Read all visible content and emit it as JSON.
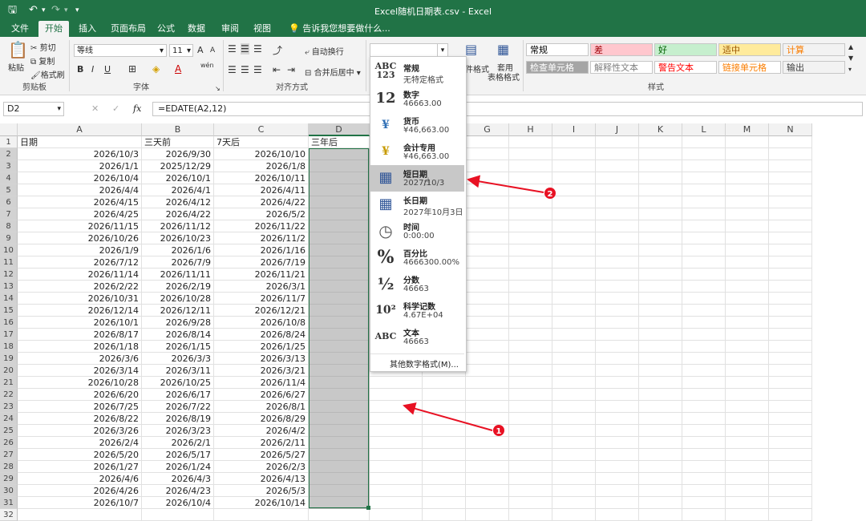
{
  "window": {
    "title": "Excel随机日期表.csv - Excel"
  },
  "tabs": [
    "文件",
    "开始",
    "插入",
    "页面布局",
    "公式",
    "数据",
    "审阅",
    "视图"
  ],
  "tell_me": "告诉我您想要做什么...",
  "clipboard": {
    "paste": "粘贴",
    "cut": "剪切",
    "copy": "复制",
    "format_painter": "格式刷",
    "label": "剪贴板"
  },
  "font": {
    "name": "等线",
    "size": "11",
    "grow": "A",
    "shrink": "A",
    "bold": "B",
    "italic": "I",
    "underline": "U",
    "color_a": "A",
    "wen": "wén",
    "label": "字体"
  },
  "alignment": {
    "wrap": "自动换行",
    "merge": "合并后居中",
    "label": "对齐方式"
  },
  "number": {
    "format_value": ""
  },
  "styles_group": {
    "cond": "件格式",
    "table": "套用",
    "table2": "表格格式",
    "label": "样式"
  },
  "styles": [
    {
      "label": "常规",
      "bg": "#ffffff",
      "fg": "#000000"
    },
    {
      "label": "差",
      "bg": "#ffc7ce",
      "fg": "#9c0006"
    },
    {
      "label": "好",
      "bg": "#c6efce",
      "fg": "#006100"
    },
    {
      "label": "适中",
      "bg": "#ffeb9c",
      "fg": "#9c5700"
    },
    {
      "label": "计算",
      "bg": "#f2f2f2",
      "fg": "#fa7d00"
    },
    {
      "label": "检查单元格",
      "bg": "#a5a5a5",
      "fg": "#ffffff"
    },
    {
      "label": "解释性文本",
      "bg": "#ffffff",
      "fg": "#7f7f7f"
    },
    {
      "label": "警告文本",
      "bg": "#ffffff",
      "fg": "#ff0000"
    },
    {
      "label": "链接单元格",
      "bg": "#ffffff",
      "fg": "#fa7d00"
    },
    {
      "label": "输出",
      "bg": "#f2f2f2",
      "fg": "#3f3f3f"
    }
  ],
  "formula_bar": {
    "cell_ref": "D2",
    "fx": "fx",
    "formula": "=EDATE(A2,12)"
  },
  "columns": [
    "A",
    "B",
    "C",
    "D",
    "E",
    "F",
    "G",
    "H",
    "I",
    "J",
    "K",
    "L",
    "M",
    "N"
  ],
  "headers": [
    "日期",
    "三天前",
    "7天后",
    "三年后"
  ],
  "rows": [
    [
      "2026/10/3",
      "2026/9/30",
      "2026/10/10"
    ],
    [
      "2026/1/1",
      "2025/12/29",
      "2026/1/8"
    ],
    [
      "2026/10/4",
      "2026/10/1",
      "2026/10/11"
    ],
    [
      "2026/4/4",
      "2026/4/1",
      "2026/4/11"
    ],
    [
      "2026/4/15",
      "2026/4/12",
      "2026/4/22"
    ],
    [
      "2026/4/25",
      "2026/4/22",
      "2026/5/2"
    ],
    [
      "2026/11/15",
      "2026/11/12",
      "2026/11/22"
    ],
    [
      "2026/10/26",
      "2026/10/23",
      "2026/11/2"
    ],
    [
      "2026/1/9",
      "2026/1/6",
      "2026/1/16"
    ],
    [
      "2026/7/12",
      "2026/7/9",
      "2026/7/19"
    ],
    [
      "2026/11/14",
      "2026/11/11",
      "2026/11/21"
    ],
    [
      "2026/2/22",
      "2026/2/19",
      "2026/3/1"
    ],
    [
      "2026/10/31",
      "2026/10/28",
      "2026/11/7"
    ],
    [
      "2026/12/14",
      "2026/12/11",
      "2026/12/21"
    ],
    [
      "2026/10/1",
      "2026/9/28",
      "2026/10/8"
    ],
    [
      "2026/8/17",
      "2026/8/14",
      "2026/8/24"
    ],
    [
      "2026/1/18",
      "2026/1/15",
      "2026/1/25"
    ],
    [
      "2026/3/6",
      "2026/3/3",
      "2026/3/13"
    ],
    [
      "2026/3/14",
      "2026/3/11",
      "2026/3/21"
    ],
    [
      "2026/10/28",
      "2026/10/25",
      "2026/11/4"
    ],
    [
      "2026/6/20",
      "2026/6/17",
      "2026/6/27"
    ],
    [
      "2026/7/25",
      "2026/7/22",
      "2026/8/1"
    ],
    [
      "2026/8/22",
      "2026/8/19",
      "2026/8/29"
    ],
    [
      "2026/3/26",
      "2026/3/23",
      "2026/4/2"
    ],
    [
      "2026/2/4",
      "2026/2/1",
      "2026/2/11"
    ],
    [
      "2026/5/20",
      "2026/5/17",
      "2026/5/27"
    ],
    [
      "2026/1/27",
      "2026/1/24",
      "2026/2/3"
    ],
    [
      "2026/4/6",
      "2026/4/3",
      "2026/4/13"
    ],
    [
      "2026/4/26",
      "2026/4/23",
      "2026/5/3"
    ],
    [
      "2026/10/7",
      "2026/10/4",
      "2026/10/14"
    ]
  ],
  "number_formats": [
    {
      "icon": "ABC\n123",
      "name": "常规",
      "sample": "无特定格式"
    },
    {
      "icon": "12",
      "name": "数字",
      "sample": "46663.00"
    },
    {
      "icon": "¥",
      "name": "货币",
      "sample": "¥46,663.00"
    },
    {
      "icon": "¥",
      "name": "会计专用",
      "sample": " ¥46,663.00"
    },
    {
      "icon": "▦",
      "name": "短日期",
      "sample": "2027/10/3"
    },
    {
      "icon": "▦",
      "name": "长日期",
      "sample": "2027年10月3日"
    },
    {
      "icon": "◷",
      "name": "时间",
      "sample": "0:00:00"
    },
    {
      "icon": "%",
      "name": "百分比",
      "sample": "4666300.00%"
    },
    {
      "icon": "½",
      "name": "分数",
      "sample": "46663"
    },
    {
      "icon": "10²",
      "name": "科学记数",
      "sample": "4.67E+04"
    },
    {
      "icon": "ABC",
      "name": "文本",
      "sample": "46663"
    }
  ],
  "more_formats": "其他数字格式(M)...",
  "annotations": [
    {
      "label": "1"
    },
    {
      "label": "2"
    }
  ],
  "colors": {
    "excel_green": "#217346",
    "selection": "#c8c8c8",
    "annotation_red": "#e81123"
  }
}
